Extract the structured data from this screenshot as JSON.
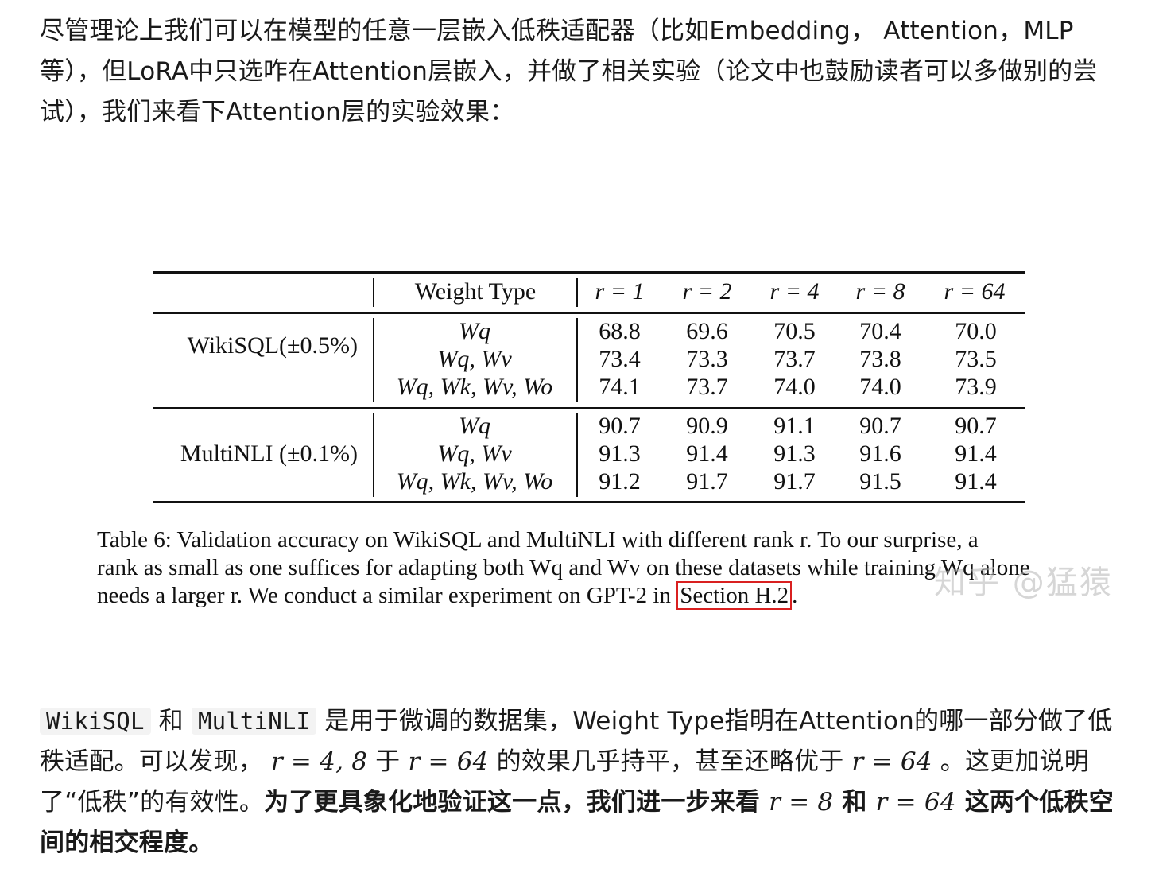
{
  "para1": {
    "text": "尽管理论上我们可以在模型的任意一层嵌入低秩适配器（比如Embedding， Attention，MLP等），但LoRA中只选咋在Attention层嵌入，并做了相关实验（论文中也鼓励读者可以多做别的尝试），我们来看下Attention层的实验效果："
  },
  "table": {
    "header": {
      "weight_type": "Weight Type",
      "ranks": [
        "r = 1",
        "r = 2",
        "r = 4",
        "r = 8",
        "r = 64"
      ]
    },
    "groups": [
      {
        "dataset": "WikiSQL(±0.5%)",
        "rows": [
          {
            "weight": "Wq",
            "values": [
              "68.8",
              "69.6",
              "70.5",
              "70.4",
              "70.0"
            ]
          },
          {
            "weight": "Wq, Wv",
            "values": [
              "73.4",
              "73.3",
              "73.7",
              "73.8",
              "73.5"
            ]
          },
          {
            "weight": "Wq, Wk, Wv, Wo",
            "values": [
              "74.1",
              "73.7",
              "74.0",
              "74.0",
              "73.9"
            ]
          }
        ]
      },
      {
        "dataset": "MultiNLI (±0.1%)",
        "rows": [
          {
            "weight": "Wq",
            "values": [
              "90.7",
              "90.9",
              "91.1",
              "90.7",
              "90.7"
            ]
          },
          {
            "weight": "Wq, Wv",
            "values": [
              "91.3",
              "91.4",
              "91.3",
              "91.6",
              "91.4"
            ]
          },
          {
            "weight": "Wq, Wk, Wv, Wo",
            "values": [
              "91.2",
              "91.7",
              "91.7",
              "91.5",
              "91.4"
            ]
          }
        ]
      }
    ]
  },
  "caption": {
    "line1": "Table 6: Validation accuracy on WikiSQL and MultiNLI with different rank r. To our surprise, a",
    "line2": "rank as small as one suffices for adapting both Wq and Wv on these datasets while training Wq alone",
    "line3_pre": "needs a larger r. We conduct a similar experiment on GPT-2 in",
    "line3_link": "Section H.2",
    "line3_post": "."
  },
  "watermark": "知乎 @猛猿",
  "para2": {
    "code1": "WikiSQL",
    "t1": " 和 ",
    "code2": "MultiNLI",
    "t2": " 是用于微调的数据集，Weight Type指明在Attention的哪一部分做了低秩适配。可以发现， ",
    "m1": "r = 4, 8",
    "t3": " 于 ",
    "m2": "r = 64",
    "t4": " 的效果几乎持平，甚至还略优于 ",
    "m3": "r = 64",
    "t5": " 。这更加说明了“低秩”的有效性。",
    "b1": "为了更具象化地验证这一点，我们进一步来看 ",
    "m4": "r = 8",
    "b2": " 和 ",
    "m5": "r = 64",
    "b3": " 这两个低秩空间的相交程度。"
  }
}
